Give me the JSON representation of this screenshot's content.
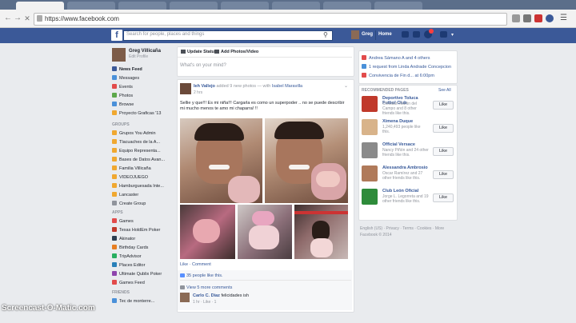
{
  "browser": {
    "url": "https://www.facebook.com"
  },
  "header": {
    "logo": "f",
    "search_placeholder": "Search for people, places and things",
    "user_name": "Greg",
    "home_label": "Home"
  },
  "sidebar": {
    "profile_name": "Greg Villicaña",
    "edit_profile": "Edit Profile",
    "main_items": [
      {
        "label": "News Feed",
        "color": "#3b5998"
      },
      {
        "label": "Messages",
        "color": "#4a90d9"
      },
      {
        "label": "Events",
        "color": "#e24b4b"
      },
      {
        "label": "Photos",
        "color": "#5ca84a"
      },
      {
        "label": "Browse",
        "color": "#4a90d9"
      },
      {
        "label": "Proyecto Graficas '13",
        "color": "#f0a830"
      }
    ],
    "groups_header": "GROUPS",
    "groups": [
      {
        "label": "Grupos You Admin",
        "color": "#f0a830"
      },
      {
        "label": "Tlacuaches de la A...",
        "color": "#f0a830"
      },
      {
        "label": "Equipo Representa...",
        "color": "#f0a830"
      },
      {
        "label": "Bases de Datos Avan...",
        "color": "#f0a830"
      },
      {
        "label": "Familia Villicaña",
        "color": "#f0a830"
      },
      {
        "label": "VIDEOJUEGO",
        "color": "#f0a830"
      },
      {
        "label": "Hamburguesada Inte...",
        "color": "#f0a830"
      },
      {
        "label": "Lancaster",
        "color": "#f0a830"
      },
      {
        "label": "Create Group",
        "color": "#90949c"
      }
    ],
    "apps_header": "APPS",
    "apps": [
      {
        "label": "Games",
        "color": "#e24b4b"
      },
      {
        "label": "Texas HoldEm Poker",
        "color": "#c0392b"
      },
      {
        "label": "Akinator",
        "color": "#2c3e50"
      },
      {
        "label": "Birthday Cards",
        "color": "#e67e22"
      },
      {
        "label": "TripAdvisor",
        "color": "#27ae60"
      },
      {
        "label": "Places Editor",
        "color": "#2980b9"
      },
      {
        "label": "Ultimate Qublix Poker",
        "color": "#8e44ad"
      },
      {
        "label": "Games Feed",
        "color": "#e24b4b"
      }
    ],
    "friends_header": "FRIENDS",
    "friends_first": "Tec de monterre..."
  },
  "composer": {
    "update_status": "Update Status",
    "add_photo": "Add Photos/Video",
    "placeholder": "What's on your mind?"
  },
  "post": {
    "author": "Ieh Vallejo",
    "action": "added 9 new photos — with",
    "tagged": "Isabel Maravilla",
    "time": "2 hrs",
    "text": "Sellie y que!!! Es mi niña!!! Cargarla es como un superpoder .. no se puede describir mi mucho menos te amo mi chaparra! !!",
    "like": "Like",
    "comment": "Comment",
    "likes_count": "35 people like this.",
    "view_comments": "View 5 more comments",
    "comment_author": "Carlo C. Diaz",
    "comment_text": "felicidades ish",
    "comment_meta": "1 hr · Like · 1"
  },
  "right": {
    "events": [
      {
        "text": "Andrea Sámano A and 4 others",
        "color": "#e24b4b"
      },
      {
        "text": "1 request from Linda Andrade Concepcion",
        "color": "#4a90d9"
      },
      {
        "text": "Convivencia de Fin d... at 6:00pm",
        "color": "#e24b4b"
      }
    ],
    "recommended_header": "RECOMMENDED PAGES",
    "see_all": "See All",
    "pages": [
      {
        "name": "Deportivo Toluca Futbol Club",
        "sub": "Christian Martin del Campo and 8 other friends like this.",
        "color": "#c0392b"
      },
      {
        "name": "Ximena Duque",
        "sub": "1,240,493 people like this.",
        "color": "#d8b38a"
      },
      {
        "name": "Official Versace",
        "sub": "Nancy Piñón and 24 other friends like this.",
        "color": "#8a8a8a"
      },
      {
        "name": "Alessandra Ambrosio",
        "sub": "Oscar Ramírez and 27 other friends like this.",
        "color": "#b07a5a"
      },
      {
        "name": "Club León Oficial",
        "sub": "Jorge L. Legorreta and 19 other friends like this.",
        "color": "#2e8b3a"
      }
    ],
    "like_label": "Like",
    "footer": "English (US) · Privacy · Terms · Cookies · More",
    "footer2": "Facebook © 2014"
  },
  "watermark": "Screencast-O-Matic.com"
}
